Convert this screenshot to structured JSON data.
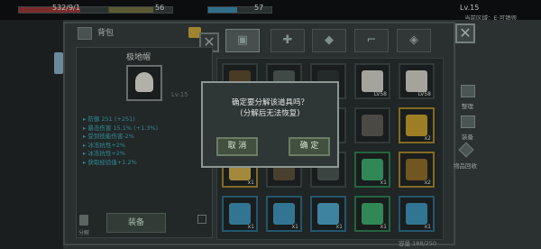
{
  "hud": {
    "hp_text": "532/9/1",
    "energy_text": "56",
    "shield_text": "57",
    "level_text": "Lv.15",
    "location_text": "当前区域：E·可销毁",
    "hp_fraction": 0.62,
    "energy_fraction": 0.7,
    "shield_fraction": 0.45
  },
  "bag": {
    "title": "背包",
    "selected_item": {
      "name": "极地帽",
      "level_text": "Lv.15",
      "stats": [
        "▸ 防御  251 (+251)",
        "▸ 暴击伤害  15.1% (+1.3%)",
        "▸ 受到技能伤害-2%",
        "▸ 冰冻抗性+2%",
        "▸ 冰冻抗性+2%",
        "▸ 获取经验值+1.2%"
      ]
    },
    "equip_label": "装备",
    "decompose_label": "分解",
    "capacity_text": "容量 188/250"
  },
  "dialog": {
    "line1": "确定要分解该道具吗？",
    "line2": "(分解后无法恢复)",
    "cancel_label": "取 消",
    "confirm_label": "确 定"
  },
  "side": {
    "btn1_label": "整理",
    "btn2_label": "装备",
    "btn3_label": "物品回收"
  },
  "slots": [
    {
      "tone": "none",
      "icon": "#5a4a2e",
      "label": ""
    },
    {
      "tone": "none",
      "icon": "#4e5a56",
      "label": ""
    },
    {
      "tone": "none",
      "icon": "#2c3333",
      "label": ""
    },
    {
      "tone": "none",
      "icon": "#c8c8c0",
      "label": "LV58"
    },
    {
      "tone": "none",
      "icon": "#c8c8c0",
      "label": "LV58"
    },
    {
      "tone": "none",
      "icon": "#2c3333",
      "label": ""
    },
    {
      "tone": "none",
      "icon": "#2c3333",
      "label": ""
    },
    {
      "tone": "none",
      "icon": "#2c3333",
      "label": ""
    },
    {
      "tone": "none",
      "icon": "#5c5a52",
      "label": ""
    },
    {
      "tone": "y",
      "icon": "#c09a2c",
      "label": "x2"
    },
    {
      "tone": "y",
      "icon": "#c9a84a",
      "label": "x1"
    },
    {
      "tone": "none",
      "icon": "#5a4e3a",
      "label": ""
    },
    {
      "tone": "none",
      "icon": "#4a5450",
      "label": ""
    },
    {
      "tone": "g",
      "icon": "#3aa66a",
      "label": "x1"
    },
    {
      "tone": "y",
      "icon": "#8a6a2a",
      "label": "x2"
    },
    {
      "tone": "b",
      "icon": "#3c8fb3",
      "label": "x1"
    },
    {
      "tone": "b",
      "icon": "#3c8fb3",
      "label": "x1"
    },
    {
      "tone": "b",
      "icon": "#4ca0c4",
      "label": "x1"
    },
    {
      "tone": "g",
      "icon": "#3aa66a",
      "label": "x1"
    },
    {
      "tone": "b",
      "icon": "#3c8fb3",
      "label": "x1"
    }
  ]
}
